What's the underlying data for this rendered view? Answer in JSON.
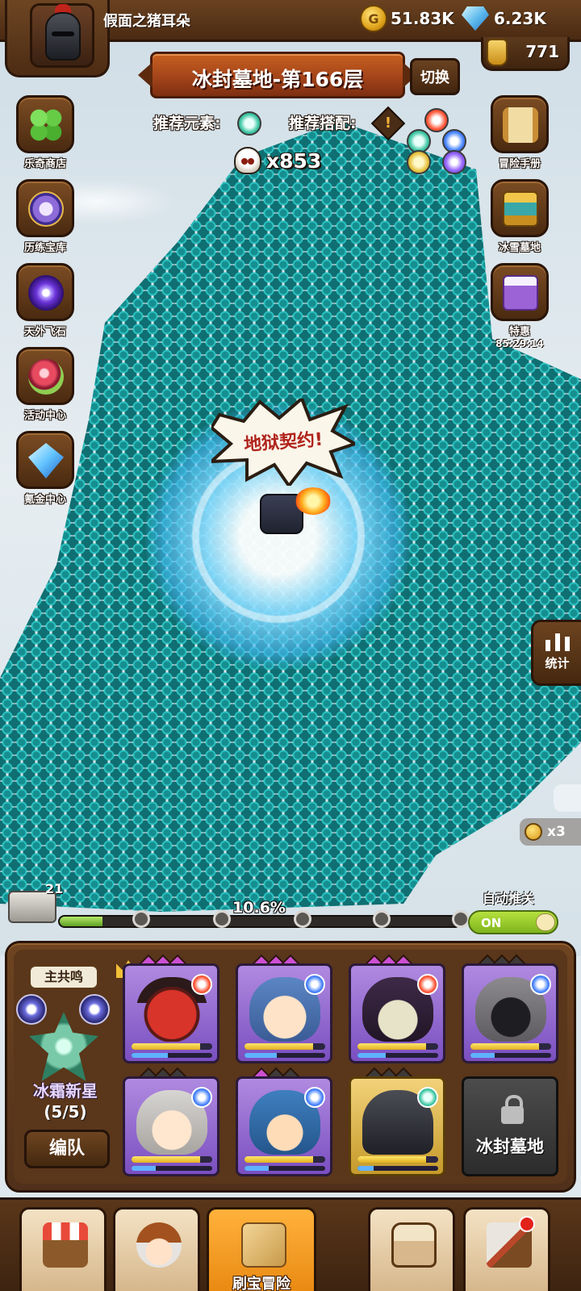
{
  "player": {
    "name": "假面之猪耳朵"
  },
  "resources": {
    "gold": "51.83K",
    "gems": "6.23K",
    "potion": "771"
  },
  "stage": {
    "title": "冰封墓地-第166层",
    "switch_label": "切换"
  },
  "recommend": {
    "element_label": "推荐元素:",
    "combo_label": "推荐搭配:"
  },
  "kills": "x853",
  "battle_shout": "地狱契约!",
  "left_menu": [
    {
      "label": "乐奇商店",
      "icon": "clover-icon"
    },
    {
      "label": "历练宝库",
      "icon": "vault-icon"
    },
    {
      "label": "天外飞石",
      "icon": "portal-icon"
    },
    {
      "label": "活动中心",
      "icon": "flower-bouquet-icon"
    },
    {
      "label": "氪金中心",
      "icon": "crystal-icon"
    }
  ],
  "right_menu": [
    {
      "label": "冒险手册",
      "icon": "scroll-icon"
    },
    {
      "label": "冰雪墓地",
      "icon": "chest-icon"
    },
    {
      "label": "特惠",
      "icon": "gift-icon",
      "timer": "85:29:14"
    }
  ],
  "stats_label": "统计",
  "coin_multiplier": "x3",
  "progress": {
    "percent_text": "10.6%",
    "value": 0.106,
    "chest_count": "21"
  },
  "auto_push": {
    "label": "自动推关",
    "state": "ON"
  },
  "team": {
    "resonance_label": "主共鸣",
    "set_name": "冰霜新星",
    "set_count": "(5/5)",
    "formation_label": "编队",
    "locked_slot_label": "冰封墓地",
    "heroes": [
      {
        "name": "red-demon",
        "element": "fire",
        "stars": 3,
        "hp": 0.85,
        "xp": 0.45
      },
      {
        "name": "blue-hair",
        "element": "water",
        "stars": 3,
        "hp": 0.85,
        "xp": 0.4
      },
      {
        "name": "witch",
        "element": "fire",
        "stars": 3,
        "hp": 0.85,
        "xp": 0.35
      },
      {
        "name": "hooded",
        "element": "water",
        "stars": 0,
        "hp": 0.85,
        "xp": 0.3
      },
      {
        "name": "silver-hair",
        "element": "water",
        "stars": 0,
        "hp": 0.85,
        "xp": 0.3
      },
      {
        "name": "blue-hood",
        "element": "water",
        "stars": 1,
        "hp": 0.85,
        "xp": 0.3
      },
      {
        "name": "knight",
        "element": "wind",
        "stars": 0,
        "hp": 0.85,
        "xp": 0.2
      }
    ]
  },
  "bottom_nav": [
    {
      "label": "",
      "icon": "shop-icon"
    },
    {
      "label": "",
      "icon": "hero-icon"
    },
    {
      "label": "刷宝冒险",
      "icon": "treasure-map-icon",
      "active": true
    },
    {
      "label": "",
      "icon": "backpack-icon"
    },
    {
      "label": "",
      "icon": "forge-icon",
      "badge": true
    }
  ]
}
